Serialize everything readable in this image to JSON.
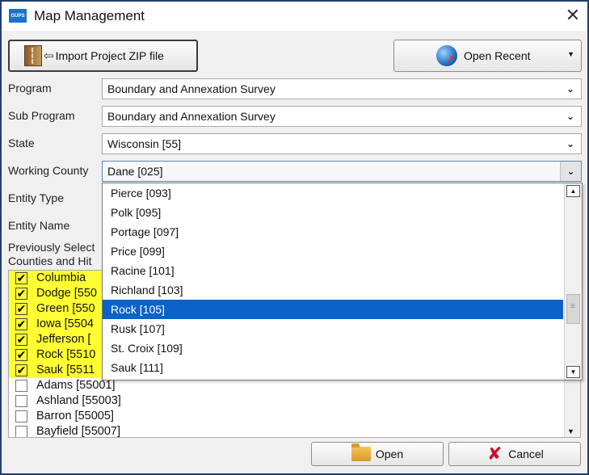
{
  "window": {
    "app_icon_text": "GUPS",
    "title": "Map Management",
    "close_glyph": "✕"
  },
  "toolbar": {
    "import_label": "Import Project ZIP file",
    "recent_label": "Open Recent",
    "recent_arrow": "▼",
    "import_arrow": "⇦"
  },
  "form": {
    "program_label": "Program",
    "program_value": "Boundary and Annexation Survey",
    "subprogram_label": "Sub Program",
    "subprogram_value": "Boundary and Annexation Survey",
    "state_label": "State",
    "state_value": "Wisconsin [55]",
    "county_label": "Working County",
    "county_value": "Dane [025]",
    "entity_type_label": "Entity Type",
    "entity_name_label": "Entity Name",
    "prev_label_line1": "Previously Select",
    "prev_label_line2": "Counties and Hit",
    "chevron": "⌄"
  },
  "county_list": {
    "check_glyph": "✔",
    "items": [
      {
        "label": "Columbia",
        "checked": true
      },
      {
        "label": "Dodge [550",
        "checked": true
      },
      {
        "label": "Green [550",
        "checked": true
      },
      {
        "label": "Iowa [5504",
        "checked": true
      },
      {
        "label": "Jefferson [",
        "checked": true
      },
      {
        "label": "Rock [5510",
        "checked": true
      },
      {
        "label": "Sauk [5511",
        "checked": true
      },
      {
        "label": "Adams [55001]",
        "checked": false
      },
      {
        "label": "Ashland [55003]",
        "checked": false
      },
      {
        "label": "Barron [55005]",
        "checked": false
      },
      {
        "label": "Bayfield [55007]",
        "checked": false
      }
    ],
    "scroll_down": "▼"
  },
  "dropdown": {
    "items": [
      {
        "label": "Pierce [093]",
        "selected": false
      },
      {
        "label": "Polk [095]",
        "selected": false
      },
      {
        "label": "Portage [097]",
        "selected": false
      },
      {
        "label": "Price [099]",
        "selected": false
      },
      {
        "label": "Racine [101]",
        "selected": false
      },
      {
        "label": "Richland [103]",
        "selected": false
      },
      {
        "label": "Rock [105]",
        "selected": true
      },
      {
        "label": "Rusk [107]",
        "selected": false
      },
      {
        "label": "St. Croix [109]",
        "selected": false
      },
      {
        "label": "Sauk [111]",
        "selected": false
      }
    ],
    "scroll_up": "▲",
    "scroll_down": "▼"
  },
  "footer": {
    "open_label": "Open",
    "cancel_label": "Cancel",
    "cancel_glyph": "✘"
  },
  "colors": {
    "selection": "#0963c8",
    "highlight": "#ffff33",
    "cancel_icon": "#c8102e"
  }
}
